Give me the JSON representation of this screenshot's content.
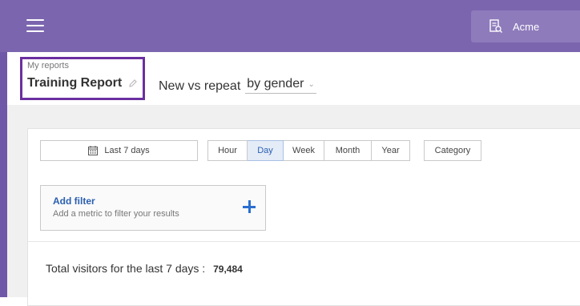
{
  "topbar": {
    "org_name": "Acme",
    "icons": {
      "menu": "hamburger-icon",
      "org": "building-report-icon"
    },
    "colors": {
      "bar": "#7b65ae",
      "org_button": "#8e7bbb"
    }
  },
  "header": {
    "breadcrumb": "My reports",
    "title": "Training Report",
    "subtitle_prefix": "New vs repeat",
    "dimension": "by gender",
    "highlight_color": "#6b2fa0"
  },
  "toolbar": {
    "date_range": "Last 7 days",
    "granularity": [
      {
        "label": "Hour",
        "active": false
      },
      {
        "label": "Day",
        "active": true
      },
      {
        "label": "Week",
        "active": false
      },
      {
        "label": "Month",
        "active": false
      },
      {
        "label": "Year",
        "active": false
      }
    ],
    "category": "Category"
  },
  "filter": {
    "title": "Add filter",
    "description": "Add a metric to filter your results"
  },
  "summary": {
    "label": "Total visitors for the last 7 days :",
    "value": "79,484"
  }
}
